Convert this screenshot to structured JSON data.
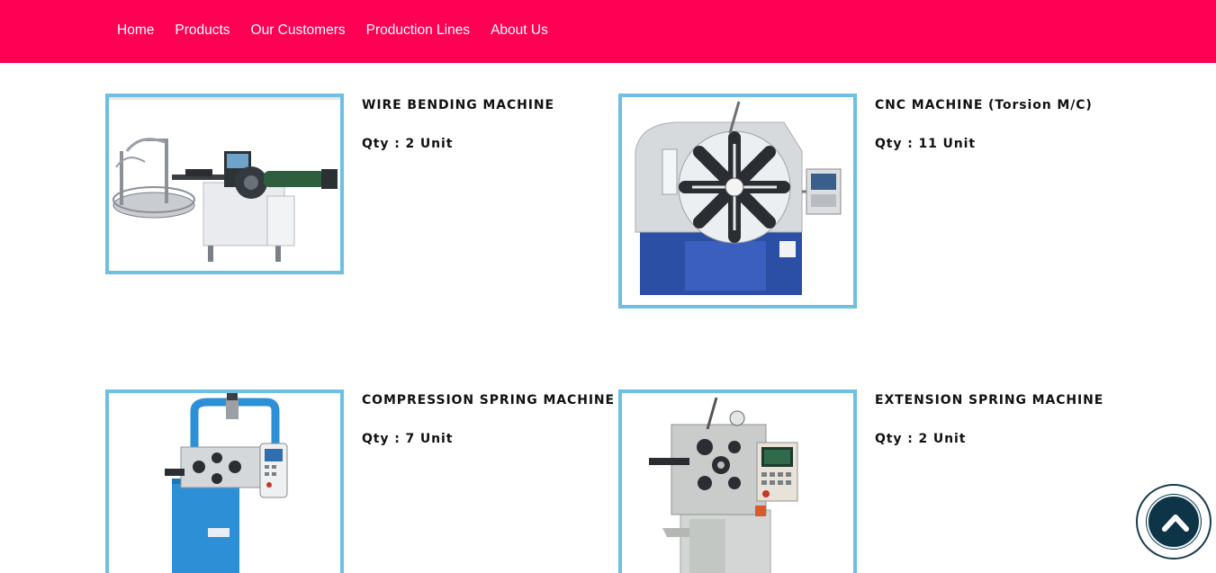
{
  "nav": {
    "items": [
      {
        "label": "Home"
      },
      {
        "label": "Products"
      },
      {
        "label": "Our Customers"
      },
      {
        "label": "Production Lines"
      },
      {
        "label": "About Us"
      }
    ]
  },
  "products": [
    {
      "title": "WIRE BENDING MACHINE",
      "qty": "Qty : 2 Unit"
    },
    {
      "title": "CNC MACHINE (Torsion M/C)",
      "qty": "Qty : 11 Unit"
    },
    {
      "title": "COMPRESSION SPRING MACHINE",
      "qty": "Qty : 7 Unit"
    },
    {
      "title": "EXTENSION SPRING MACHINE",
      "qty": "Qty : 2 Unit"
    }
  ],
  "scroll_top": {
    "icon": "chevron-up-icon"
  },
  "colors": {
    "nav_bg": "#ff0055",
    "frame_border": "#6ebfe0",
    "scroll_button": "#0d3447"
  }
}
